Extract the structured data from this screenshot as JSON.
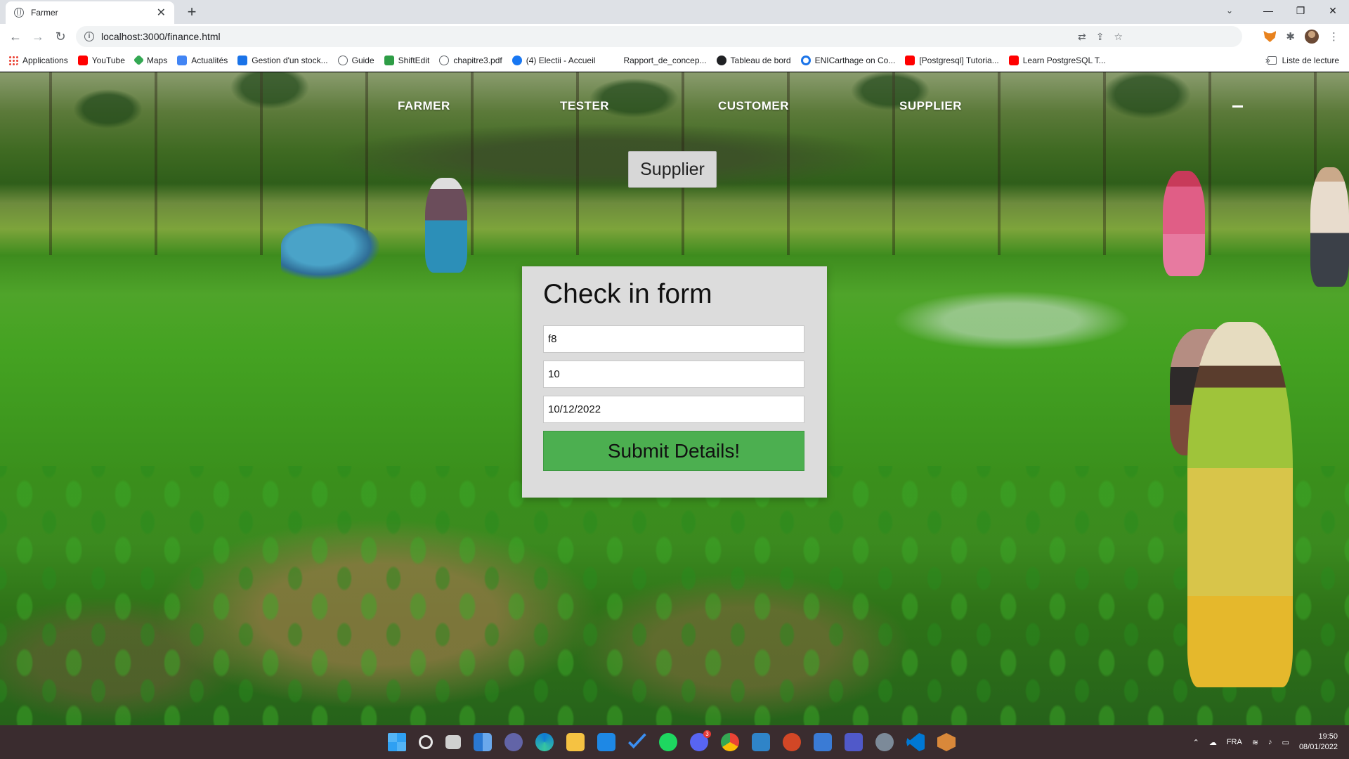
{
  "browser": {
    "tab_title": "Farmer",
    "tab_close": "✕",
    "new_tab": "+",
    "url": "localhost:3000/finance.html",
    "bookmarks": [
      {
        "label": "Applications",
        "icon": "apps-grid-icon"
      },
      {
        "label": "YouTube",
        "icon": "youtube-icon"
      },
      {
        "label": "Maps",
        "icon": "maps-pin-icon"
      },
      {
        "label": "Actualités",
        "icon": "news-icon"
      },
      {
        "label": "Gestion d'un stock...",
        "icon": "code-icon"
      },
      {
        "label": "Guide",
        "icon": "globe-icon"
      },
      {
        "label": "ShiftEdit",
        "icon": "shiftedit-icon"
      },
      {
        "label": "chapitre3.pdf",
        "icon": "globe-icon"
      },
      {
        "label": "(4) Electii - Accueil",
        "icon": "facebook-icon"
      },
      {
        "label": "Rapport_de_concep...",
        "icon": "none"
      },
      {
        "label": "Tableau de bord",
        "icon": "github-icon"
      },
      {
        "label": "ENICarthage on Co...",
        "icon": "coursera-icon"
      },
      {
        "label": "[Postgresql] Tutoria...",
        "icon": "youtube-icon"
      },
      {
        "label": "Learn PostgreSQL T...",
        "icon": "youtube-icon"
      }
    ],
    "bookmarks_more": "»",
    "reading_list": "Liste de lecture"
  },
  "page": {
    "nav": [
      {
        "label": "FARMER"
      },
      {
        "label": "TESTER"
      },
      {
        "label": "CUSTOMER"
      },
      {
        "label": "SUPPLIER"
      }
    ],
    "role_button": "Supplier",
    "form": {
      "title": "Check in form",
      "field1_value": "f8",
      "field2_value": "10",
      "field3_value": "10/12/2022",
      "submit_label": "Submit Details!"
    }
  },
  "taskbar": {
    "language": "FRA",
    "time": "19:50",
    "date": "08/01/2022",
    "discord_badge": "3"
  },
  "colors": {
    "submit_green": "#4caf50",
    "card_bg": "#dcdcdc",
    "taskbar_bg": "#3a2c2f"
  }
}
